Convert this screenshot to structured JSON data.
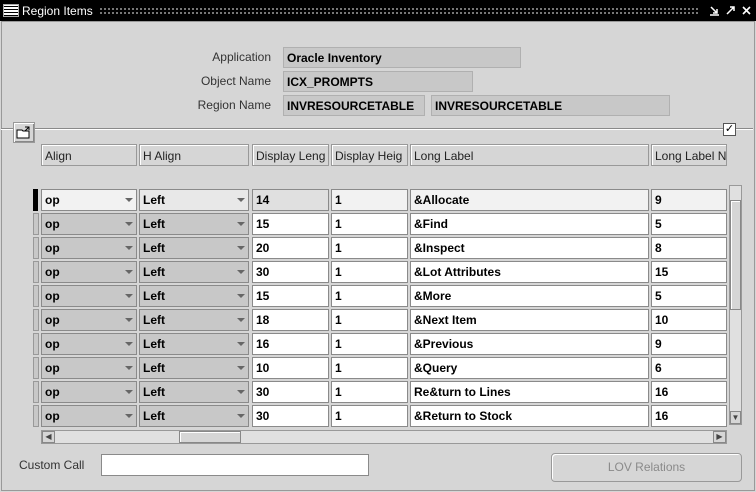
{
  "window": {
    "title": "Region Items",
    "controls": [
      "minimize-icon",
      "maximize-icon",
      "close-icon"
    ]
  },
  "header": {
    "application_label": "Application",
    "application_value": "Oracle Inventory",
    "object_label": "Object Name",
    "object_value": "ICX_PROMPTS",
    "region_label": "Region Name",
    "region_code": "INVRESOURCETABLE",
    "region_name": "INVRESOURCETABLE"
  },
  "grid": {
    "columns": [
      "Align",
      "H Align",
      "Display Leng",
      "Display Heig",
      "Long Label",
      "Long Label N"
    ],
    "rows": [
      {
        "align": "op",
        "h_align": "Left",
        "display_length": "14",
        "display_height": "1",
        "long_label": "&Allocate",
        "long_label_n": "9"
      },
      {
        "align": "op",
        "h_align": "Left",
        "display_length": "15",
        "display_height": "1",
        "long_label": "&Find",
        "long_label_n": "5"
      },
      {
        "align": "op",
        "h_align": "Left",
        "display_length": "20",
        "display_height": "1",
        "long_label": "&Inspect",
        "long_label_n": "8"
      },
      {
        "align": "op",
        "h_align": "Left",
        "display_length": "30",
        "display_height": "1",
        "long_label": "&Lot Attributes",
        "long_label_n": "15"
      },
      {
        "align": "op",
        "h_align": "Left",
        "display_length": "15",
        "display_height": "1",
        "long_label": "&More",
        "long_label_n": "5"
      },
      {
        "align": "op",
        "h_align": "Left",
        "display_length": "18",
        "display_height": "1",
        "long_label": "&Next Item",
        "long_label_n": "10"
      },
      {
        "align": "op",
        "h_align": "Left",
        "display_length": "16",
        "display_height": "1",
        "long_label": "&Previous",
        "long_label_n": "9"
      },
      {
        "align": "op",
        "h_align": "Left",
        "display_length": "10",
        "display_height": "1",
        "long_label": "&Query",
        "long_label_n": "6"
      },
      {
        "align": "op",
        "h_align": "Left",
        "display_length": "30",
        "display_height": "1",
        "long_label": "Re&turn to Lines",
        "long_label_n": "16"
      },
      {
        "align": "op",
        "h_align": "Left",
        "display_length": "30",
        "display_height": "1",
        "long_label": "&Return to Stock",
        "long_label_n": "16"
      }
    ]
  },
  "footer": {
    "custom_call_label": "Custom Call",
    "custom_call_value": "",
    "lov_button_label": "LOV Relations"
  }
}
